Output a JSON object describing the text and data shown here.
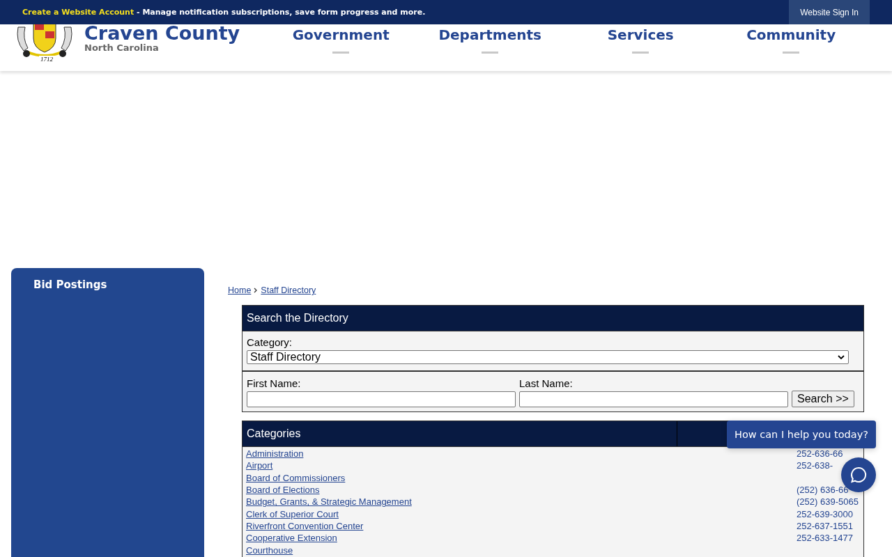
{
  "top_bar": {
    "link": "Create a Website Account",
    "message": " - Manage notification subscriptions, save form progress and more.",
    "sign_in": "Website Sign In"
  },
  "header": {
    "title": "Craven County",
    "subtitle": "North Carolina",
    "crest_year": "1712",
    "nav": [
      "Government",
      "Departments",
      "Services",
      "Community"
    ]
  },
  "sidebar": {
    "items": [
      "Bid Postings"
    ]
  },
  "breadcrumb": [
    {
      "label": "Home"
    },
    {
      "label": "Staff Directory"
    }
  ],
  "search": {
    "title": "Search the Directory",
    "category_label": "Category:",
    "category_value": "Staff Directory",
    "first_name_label": "First Name:",
    "last_name_label": "Last Name:",
    "button": "Search >>"
  },
  "categories": {
    "title": "Categories",
    "rows": [
      {
        "name": "Administration",
        "phone": "252-636-66"
      },
      {
        "name": "Airport",
        "phone": "252-638-"
      },
      {
        "name": "Board of Commissioners",
        "phone": ""
      },
      {
        "name": "Board of Elections",
        "phone": "(252) 636-66"
      },
      {
        "name": "Budget, Grants, & Strategic Management",
        "phone": "(252) 639-5065"
      },
      {
        "name": "Clerk of Superior Court",
        "phone": "252-639-3000"
      },
      {
        "name": "Riverfront Convention Center",
        "phone": "252-637-1551"
      },
      {
        "name": "Cooperative Extension",
        "phone": "252-633-1477"
      },
      {
        "name": "Courthouse",
        "phone": ""
      }
    ]
  },
  "chat": {
    "prompt": "How can I help you today?"
  }
}
